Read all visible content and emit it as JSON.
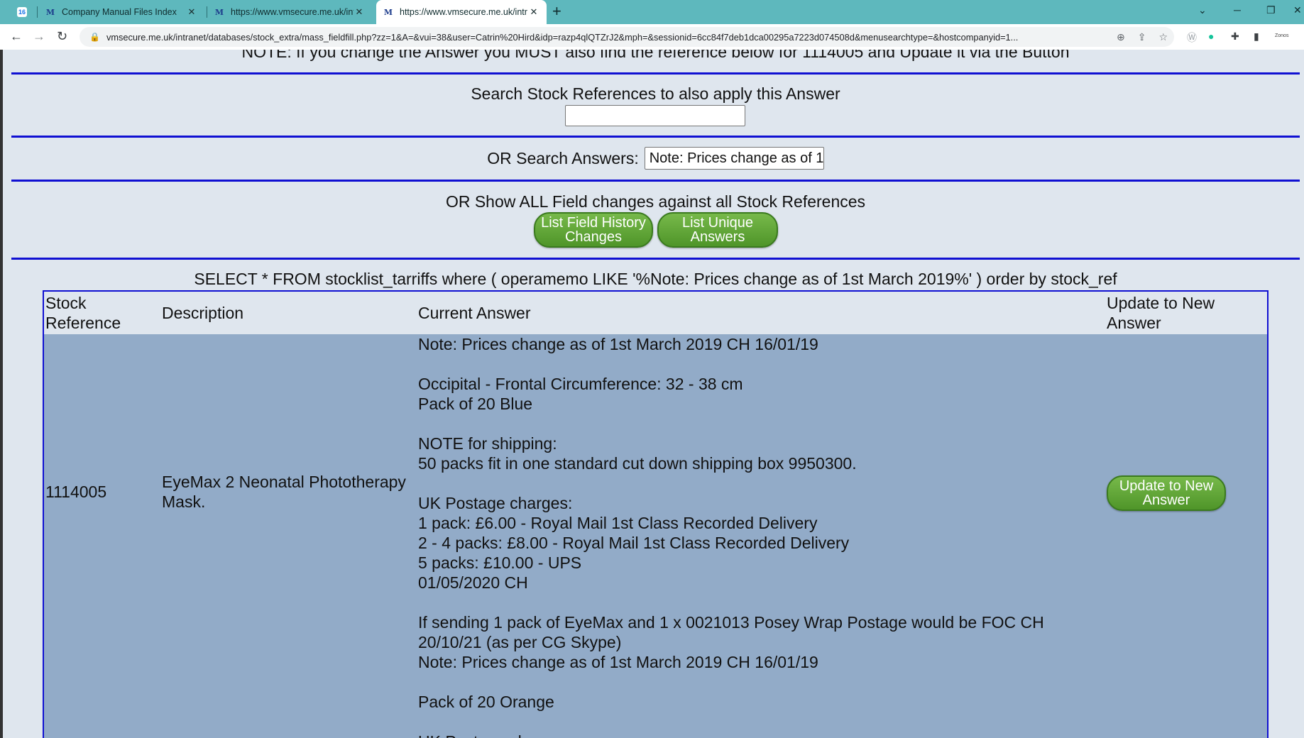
{
  "browser": {
    "tabs": [
      {
        "title": "Company Manual Files Index",
        "favicon": "M"
      },
      {
        "title": "https://www.vmsecure.me.uk/intr",
        "favicon": "M"
      },
      {
        "title": "https://www.vmsecure.me.uk/intr",
        "favicon": "M"
      }
    ],
    "pinned_badge": "16",
    "url": "vmsecure.me.uk/intranet/databases/stock_extra/mass_fieldfill.php?zz=1&A=&vui=38&user=Catrin%20Hird&idp=razp4qlQTZrJ2&mph=&sessionid=6cc84f7deb1dca00295a7223d074508d&menusearchtype=&hostcompanyid=1...",
    "extension_label": "Zonos"
  },
  "page": {
    "note_cutoff": "NOTE: If you change the Answer you MUST also find the reference below for 1114005 and Update it via the Button",
    "search_refs_label": "Search Stock References to also apply this Answer",
    "search_refs_value": "",
    "search_answers_label": "OR Search Answers:",
    "search_answers_value": "Note: Prices change as of 1",
    "show_all_label": "OR Show ALL Field changes against all Stock References",
    "btn_history": "List Field History Changes",
    "btn_unique": "List Unique Answers",
    "sql": "SELECT * FROM stocklist_tarriffs where ( operamemo LIKE '%Note: Prices change as of 1st March 2019%' ) order by stock_ref"
  },
  "table": {
    "headers": {
      "stock_ref": "Stock Reference",
      "description": "Description",
      "current_answer": "Current Answer",
      "update": "Update to New Answer"
    },
    "row": {
      "stock_ref": "1114005",
      "description": "EyeMax 2 Neonatal Phototherapy Mask.",
      "update_button": "Update to New Answer",
      "answer_lines": [
        "Note: Prices change as of 1st March 2019 CH 16/01/19",
        "",
        "Occipital - Frontal Circumference: 32 - 38 cm",
        "Pack of 20 Blue",
        "",
        "NOTE for shipping:",
        "50 packs fit in one standard cut down shipping box 9950300.",
        "",
        "UK Postage charges:",
        "1 pack: £6.00 - Royal Mail 1st Class Recorded Delivery",
        "2 - 4 packs: £8.00 - Royal Mail 1st Class Recorded Delivery",
        "5 packs: £10.00 - UPS",
        "01/05/2020 CH",
        "",
        "If sending 1 pack of EyeMax and 1 x 0021013 Posey Wrap Postage would be FOC CH",
        "20/10/21 (as per CG Skype)",
        "Note: Prices change as of 1st March 2019 CH 16/01/19",
        "",
        "Pack of 20 Orange",
        "",
        "UK Postage charges:"
      ]
    }
  }
}
